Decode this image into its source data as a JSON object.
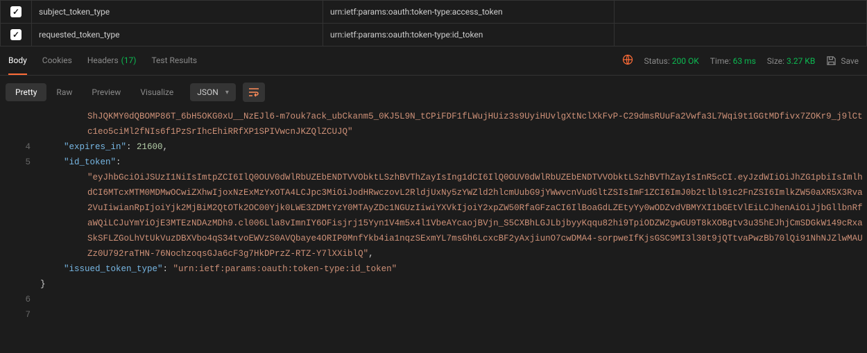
{
  "params": [
    {
      "key": "subject_token_type",
      "value": "urn:ietf:params:oauth:token-type:access_token",
      "checked": true
    },
    {
      "key": "requested_token_type",
      "value": "urn:ietf:params:oauth:token-type:id_token",
      "checked": true
    }
  ],
  "tabs": {
    "body": "Body",
    "cookies": "Cookies",
    "headers": "Headers",
    "headers_count": "(17)",
    "test_results": "Test Results"
  },
  "status": {
    "status_label": "Status:",
    "status_value": "200 OK",
    "time_label": "Time:",
    "time_value": "63 ms",
    "size_label": "Size:",
    "size_value": "3.27 KB",
    "save": "Save"
  },
  "viewmodes": {
    "pretty": "Pretty",
    "raw": "Raw",
    "preview": "Preview",
    "visualize": "Visualize"
  },
  "dropdown": {
    "value": "JSON"
  },
  "json_body": {
    "truncated_token_frag": "ShJQKMY0dQBOMP86T_6bH5OKG0xU__NzEJl6-m7ouk7ack_ubCkanm5_0KJ5L9N_tCPiFDF1fLWujHUiz3s9UyiHUvlgXtNclXkFvP-C29dmsRUuFa2Vwfa3L7Wqi9t1GGtMDfivx7ZOKr9_j9lCtc1eo5ciMl2fNIs6f1PzSrIhcEhiRRfXP1SPIVwcnJKZQlZCUJQ\"",
    "expires_in_key": "\"expires_in\"",
    "expires_in_val": "21600",
    "id_token_key": "\"id_token\"",
    "id_token_val": "\"eyJhbGciOiJSUzI1NiIsImtpZCI6IlQ0OUV0dWlRbUZEbENDTVVObktLSzhBVThZayIsIng1dCI6IlQ0OUV0dWlRbUZEbENDTVVObktLSzhBVThZayIsInR5cCI.eyJzdWIiOiJhZG1pbiIsImlhdCI6MTcxMTM0MDMwOCwiZXhwIjoxNzExMzYxOTA4LCJpc3MiOiJodHRwczovL2RldjUxNy5zYWZld2hlcmUubG9jYWwvcnVudGltZSIsImF1ZCI6ImJ0b2tlbl91c2FnZSI6ImlkZW50aXR5X3Rva2VuIiwianRpIjoiYjk2MjBiM2QtOTk2OC00Yjk0LWE3ZDMtYzY0MTAyZDc1NGUzIiwiYXVkIjoiY2xpZW50RfaGFzaCI6IlBoaGdLZEtyYy0wODZvdVBMYXI1bGEtVlEiLCJhenAiOiJjbGllbnRfaWQiLCJuYmYiOjE3MTEzNDAzMDh9.cl006Lla8vImnIY6OFisjrj15Yyn1V4m5x4l1VbeAYcaojBVjn_S5CXBhLGJLbjbyyKqqu82hi9TpiODZW2gwGU9T8kXOBgtv3u35hEJhjCmSDGkW149cRxaSkSFLZGoLhVtUkVuzDBXVbo4qS34tvoEWVzS0AVQbaye4ORIP0MnfYkb4ia1nqzSExmYL7msGh6LcxcBF2yAxjiunO7cwDMA4-sorpweIfKjsGSC9MI3l30t9jQTtvaPwzBb70lQi91NhNJZlwMAUZz0U792raTHN-76NochzoqsGJa6cF3g7HkDPrzZ-RTZ-Y7lXXiblQ\"",
    "issued_key": "\"issued_token_type\"",
    "issued_val": "\"urn:ietf:params:oauth:token-type:id_token\"",
    "close_brace": "}"
  },
  "gutter": {
    "l4": "4",
    "l5": "5",
    "l6": "6",
    "l7": "7"
  }
}
